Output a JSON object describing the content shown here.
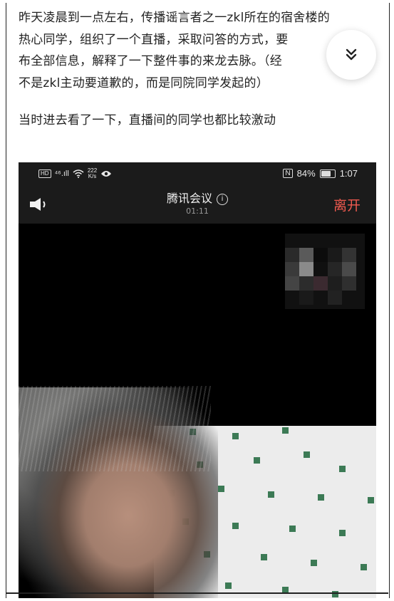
{
  "article": {
    "lines": [
      "昨天凌晨到一点左右，传播谣言者之一zkl所在的宿舍楼的",
      "热心同学，组织了一个直播，采取问答的方式，要",
      "布全部信息，解释了一下整件事的来龙去脉。（经",
      "不是zkl主动要道歉的，而是同院同学发起的）",
      "当时进去看了一下，直播间的同学也都比较激动"
    ]
  },
  "collapse_button": {
    "icon": "double-chevron-down-icon"
  },
  "screenshot": {
    "status_bar": {
      "hd": "HD",
      "signal": "⁴⁶.ıll",
      "speed_value": "222",
      "speed_unit": "K/s",
      "nfc": "N",
      "battery_percent": "84%",
      "battery_level": 0.84,
      "time": "1:07"
    },
    "meeting": {
      "title": "腾讯会议",
      "info_icon": "i",
      "timer": "01:11",
      "leave_label": "离开",
      "leave_color": "#f05a4f"
    },
    "icons": [
      "speaker-icon",
      "info-icon",
      "wifi-icon",
      "eye-icon",
      "battery-icon",
      "signal-icon"
    ]
  }
}
